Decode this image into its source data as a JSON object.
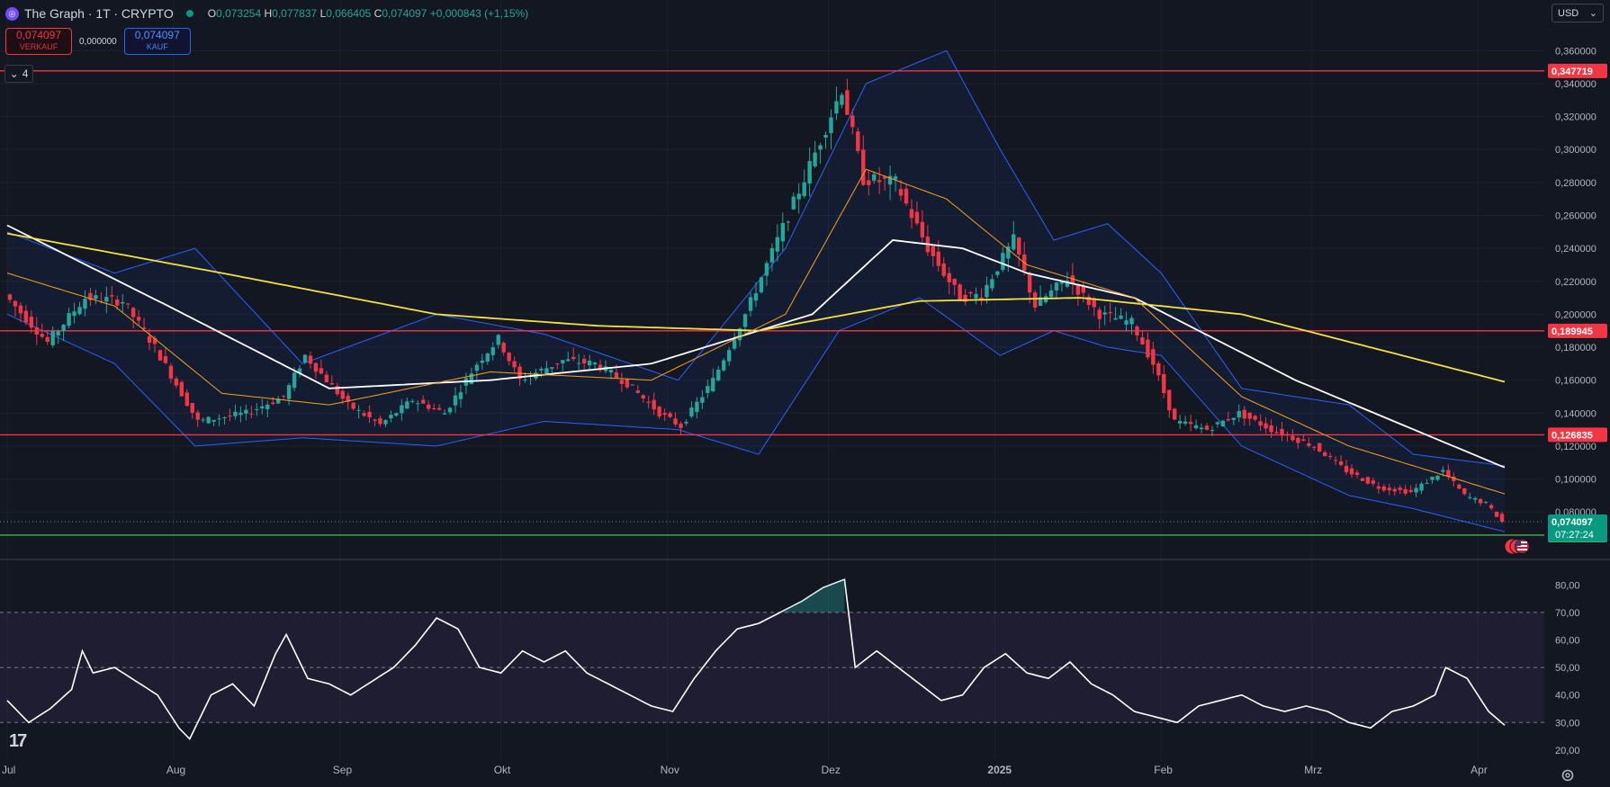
{
  "header": {
    "symbol": "The Graph · 1T · CRYPTO",
    "open_label": "O",
    "open": "0,073254",
    "high_label": "H",
    "high": "0,077837",
    "low_label": "L",
    "low": "0,066405",
    "close_label": "C",
    "close": "0,074097",
    "change": "+0,000843 (+1,15%)"
  },
  "trade": {
    "sell_price": "0,074097",
    "sell_label": "VERKAUF",
    "spread": "0,000000",
    "buy_price": "0,074097",
    "buy_label": "KAUF"
  },
  "indicators_collapsed": "4",
  "currency": "USD",
  "colors": {
    "background": "#131722",
    "up": "#26a69a",
    "down": "#f23645",
    "bollinger": "#2962ff",
    "ma_white": "#ffffff",
    "ma_yellow": "#f5e042",
    "ma_orange": "#f7a21b",
    "support_green": "#4caf50"
  },
  "chart_data": {
    "type": "candlestick",
    "price_axis": {
      "min": 0.055,
      "max": 0.37,
      "ticks": [
        "0,360000",
        "0,340000",
        "0,320000",
        "0,300000",
        "0,280000",
        "0,260000",
        "0,240000",
        "0,220000",
        "0,200000",
        "0,180000",
        "0,160000",
        "0,140000",
        "0,120000",
        "0,100000",
        "0,080000"
      ]
    },
    "time_axis": {
      "labels": [
        "Jul",
        "Aug",
        "Sep",
        "Okt",
        "Nov",
        "Dez",
        "2025",
        "Feb",
        "Mrz",
        "Apr"
      ],
      "label_days": [
        0,
        31,
        62,
        92,
        123,
        153,
        184,
        215,
        243,
        274
      ],
      "last_day": 279
    },
    "price_keypoints": [
      [
        0,
        0.212
      ],
      [
        8,
        0.183
      ],
      [
        15,
        0.21
      ],
      [
        22,
        0.208
      ],
      [
        28,
        0.18
      ],
      [
        36,
        0.135
      ],
      [
        45,
        0.14
      ],
      [
        52,
        0.15
      ],
      [
        56,
        0.175
      ],
      [
        64,
        0.145
      ],
      [
        70,
        0.133
      ],
      [
        76,
        0.148
      ],
      [
        82,
        0.14
      ],
      [
        88,
        0.17
      ],
      [
        92,
        0.185
      ],
      [
        96,
        0.16
      ],
      [
        104,
        0.172
      ],
      [
        110,
        0.17
      ],
      [
        116,
        0.158
      ],
      [
        122,
        0.14
      ],
      [
        126,
        0.132
      ],
      [
        132,
        0.16
      ],
      [
        138,
        0.2
      ],
      [
        144,
        0.245
      ],
      [
        150,
        0.29
      ],
      [
        156,
        0.337
      ],
      [
        160,
        0.282
      ],
      [
        166,
        0.28
      ],
      [
        172,
        0.24
      ],
      [
        178,
        0.21
      ],
      [
        182,
        0.212
      ],
      [
        188,
        0.245
      ],
      [
        192,
        0.205
      ],
      [
        198,
        0.222
      ],
      [
        204,
        0.2
      ],
      [
        210,
        0.195
      ],
      [
        214,
        0.17
      ],
      [
        218,
        0.135
      ],
      [
        224,
        0.13
      ],
      [
        230,
        0.14
      ],
      [
        236,
        0.13
      ],
      [
        244,
        0.12
      ],
      [
        250,
        0.105
      ],
      [
        256,
        0.095
      ],
      [
        262,
        0.092
      ],
      [
        268,
        0.105
      ],
      [
        272,
        0.09
      ],
      [
        276,
        0.085
      ],
      [
        279,
        0.074
      ]
    ],
    "moving_averages": [
      {
        "color": "white",
        "points": [
          [
            0,
            0.254
          ],
          [
            30,
            0.205
          ],
          [
            60,
            0.155
          ],
          [
            90,
            0.16
          ],
          [
            120,
            0.17
          ],
          [
            150,
            0.2
          ],
          [
            165,
            0.245
          ],
          [
            178,
            0.24
          ],
          [
            190,
            0.225
          ],
          [
            210,
            0.21
          ],
          [
            240,
            0.16
          ],
          [
            279,
            0.107
          ]
        ]
      },
      {
        "color": "yellow",
        "points": [
          [
            0,
            0.249
          ],
          [
            40,
            0.225
          ],
          [
            80,
            0.2
          ],
          [
            110,
            0.193
          ],
          [
            140,
            0.19
          ],
          [
            170,
            0.208
          ],
          [
            200,
            0.21
          ],
          [
            230,
            0.2
          ],
          [
            279,
            0.159
          ]
        ]
      },
      {
        "color": "orange",
        "points": [
          [
            0,
            0.225
          ],
          [
            20,
            0.205
          ],
          [
            40,
            0.152
          ],
          [
            60,
            0.145
          ],
          [
            90,
            0.165
          ],
          [
            120,
            0.16
          ],
          [
            145,
            0.2
          ],
          [
            160,
            0.288
          ],
          [
            175,
            0.27
          ],
          [
            190,
            0.23
          ],
          [
            210,
            0.21
          ],
          [
            230,
            0.15
          ],
          [
            250,
            0.12
          ],
          [
            279,
            0.091
          ]
        ]
      }
    ],
    "bollinger_upper": [
      [
        0,
        0.25
      ],
      [
        20,
        0.225
      ],
      [
        35,
        0.24
      ],
      [
        55,
        0.17
      ],
      [
        80,
        0.2
      ],
      [
        100,
        0.188
      ],
      [
        125,
        0.16
      ],
      [
        145,
        0.24
      ],
      [
        160,
        0.34
      ],
      [
        175,
        0.36
      ],
      [
        185,
        0.3
      ],
      [
        195,
        0.245
      ],
      [
        205,
        0.255
      ],
      [
        215,
        0.225
      ],
      [
        230,
        0.155
      ],
      [
        250,
        0.145
      ],
      [
        262,
        0.115
      ],
      [
        279,
        0.108
      ]
    ],
    "bollinger_lower": [
      [
        0,
        0.2
      ],
      [
        20,
        0.17
      ],
      [
        35,
        0.12
      ],
      [
        55,
        0.125
      ],
      [
        80,
        0.12
      ],
      [
        100,
        0.135
      ],
      [
        125,
        0.13
      ],
      [
        140,
        0.115
      ],
      [
        155,
        0.19
      ],
      [
        170,
        0.21
      ],
      [
        185,
        0.175
      ],
      [
        195,
        0.19
      ],
      [
        205,
        0.18
      ],
      [
        215,
        0.175
      ],
      [
        230,
        0.12
      ],
      [
        250,
        0.09
      ],
      [
        262,
        0.082
      ],
      [
        279,
        0.068
      ]
    ],
    "horizontal_lines": [
      {
        "value": 0.347719,
        "label": "0,347719",
        "color": "#f23645"
      },
      {
        "value": 0.189945,
        "label": "0,189945",
        "color": "#f23645"
      },
      {
        "value": 0.126835,
        "label": "0,126835",
        "color": "#f23645"
      },
      {
        "value": 0.06594,
        "label": "0,065940",
        "color": "#4caf50"
      }
    ],
    "last_price": {
      "value": 0.074097,
      "label": "0,074097",
      "countdown": "07:27:24"
    },
    "rsi": {
      "min": 18,
      "max": 85,
      "ticks": [
        "80,00",
        "70,00",
        "60,00",
        "50,00",
        "40,00",
        "30,00",
        "20,00"
      ],
      "band": [
        30,
        70
      ],
      "mid": 50,
      "keypoints": [
        [
          0,
          38
        ],
        [
          4,
          30
        ],
        [
          8,
          35
        ],
        [
          12,
          42
        ],
        [
          14,
          56
        ],
        [
          16,
          48
        ],
        [
          20,
          50
        ],
        [
          24,
          45
        ],
        [
          28,
          40
        ],
        [
          32,
          28
        ],
        [
          34,
          24
        ],
        [
          38,
          40
        ],
        [
          42,
          44
        ],
        [
          46,
          36
        ],
        [
          50,
          55
        ],
        [
          52,
          62
        ],
        [
          56,
          46
        ],
        [
          60,
          44
        ],
        [
          64,
          40
        ],
        [
          68,
          45
        ],
        [
          72,
          50
        ],
        [
          76,
          58
        ],
        [
          80,
          68
        ],
        [
          84,
          64
        ],
        [
          88,
          50
        ],
        [
          92,
          48
        ],
        [
          96,
          56
        ],
        [
          100,
          52
        ],
        [
          104,
          56
        ],
        [
          108,
          48
        ],
        [
          112,
          44
        ],
        [
          116,
          40
        ],
        [
          120,
          36
        ],
        [
          124,
          34
        ],
        [
          128,
          46
        ],
        [
          132,
          56
        ],
        [
          136,
          64
        ],
        [
          140,
          66
        ],
        [
          144,
          70
        ],
        [
          148,
          74
        ],
        [
          152,
          79
        ],
        [
          156,
          82
        ],
        [
          158,
          50
        ],
        [
          162,
          56
        ],
        [
          166,
          50
        ],
        [
          170,
          44
        ],
        [
          174,
          38
        ],
        [
          178,
          40
        ],
        [
          182,
          50
        ],
        [
          186,
          55
        ],
        [
          190,
          48
        ],
        [
          194,
          46
        ],
        [
          198,
          52
        ],
        [
          202,
          44
        ],
        [
          206,
          40
        ],
        [
          210,
          34
        ],
        [
          214,
          32
        ],
        [
          218,
          30
        ],
        [
          222,
          36
        ],
        [
          226,
          38
        ],
        [
          230,
          40
        ],
        [
          234,
          36
        ],
        [
          238,
          34
        ],
        [
          242,
          36
        ],
        [
          246,
          34
        ],
        [
          250,
          30
        ],
        [
          254,
          28
        ],
        [
          258,
          34
        ],
        [
          262,
          36
        ],
        [
          266,
          40
        ],
        [
          268,
          50
        ],
        [
          272,
          46
        ],
        [
          276,
          34
        ],
        [
          279,
          29
        ]
      ]
    }
  }
}
